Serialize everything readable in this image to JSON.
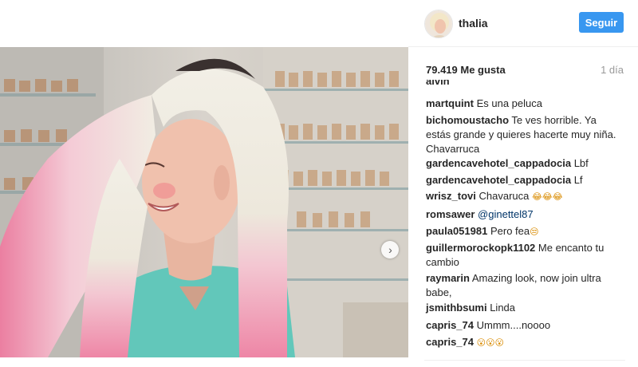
{
  "post": {
    "username": "thalia",
    "follow_label": "Seguir",
    "likes": "79.419 Me gusta",
    "time": "1 día"
  },
  "comments": [
    {
      "user": "martquint",
      "text": "Es una peluca"
    },
    {
      "user": "bichomoustacho",
      "text": "Te ves horrible. Ya estás grande y quieres hacerte muy niña. Chavarruca"
    },
    {
      "user": "gardencavehotel_cappadocia",
      "text": "Lbf"
    },
    {
      "user": "gardencavehotel_cappadocia",
      "text": "Lf"
    },
    {
      "user": "wrisz_tovi",
      "text": "Chavaruca",
      "emoji": "😂😂😂"
    },
    {
      "user": "romsawer",
      "mention": "@ginettel87"
    },
    {
      "user": "paula051981",
      "text": "Pero fea",
      "emoji": "😒"
    },
    {
      "user": "guillermorockopk1102",
      "text": "Me encanto tu cambio"
    },
    {
      "user": "raymarin",
      "text": "Amazing look, now join ultra babe,"
    },
    {
      "user": "jsmithbsumi",
      "text": "Linda"
    },
    {
      "user": "capris_74",
      "text": "Ummm....noooo"
    },
    {
      "user": "capris_74",
      "emoji": "😮😮😮"
    }
  ],
  "cut_off_user": "alvin",
  "icons": {
    "next": "chevron-right-icon"
  },
  "colors": {
    "follow_bg": "#3897f0",
    "mention": "#003569",
    "time": "#999999"
  }
}
